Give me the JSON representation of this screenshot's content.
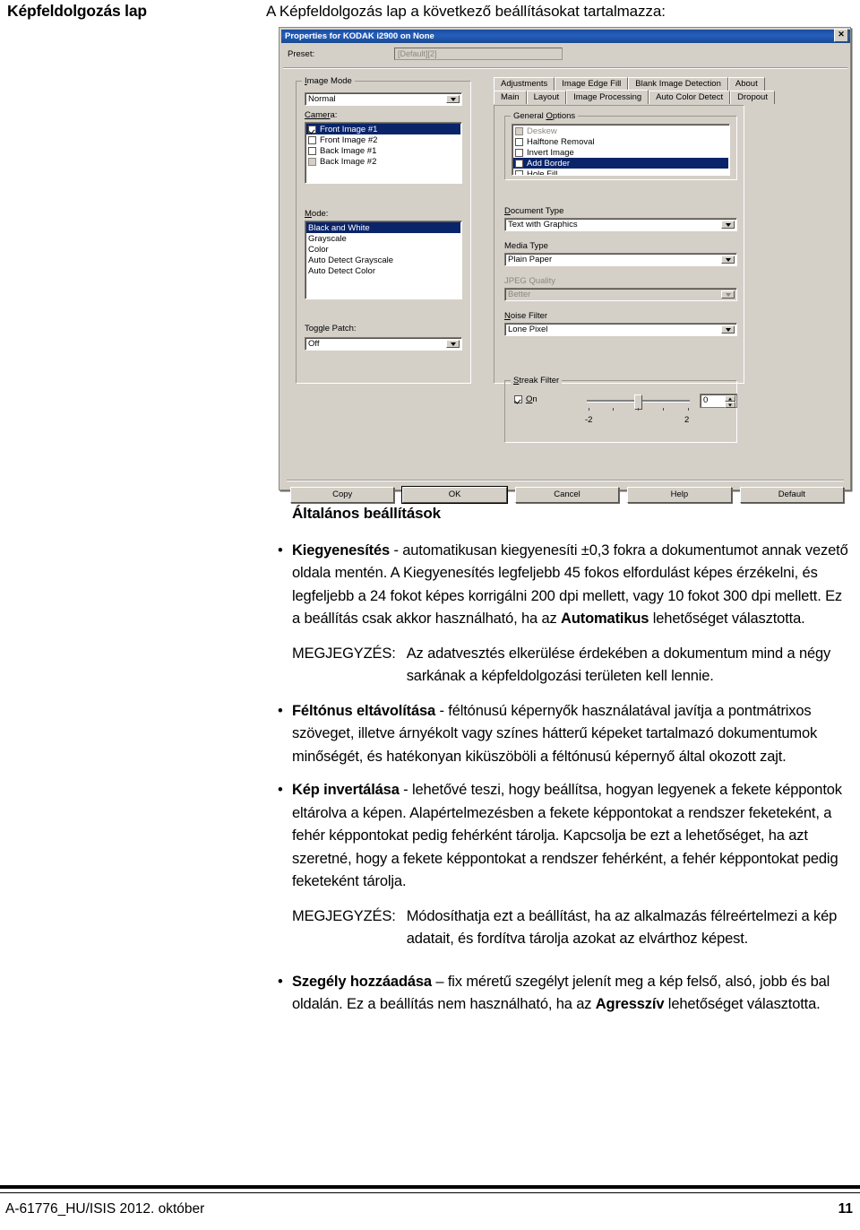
{
  "header": {
    "title": "Képfeldolgozás lap",
    "intro": "A Képfeldolgozás lap a következő beállításokat tartalmazza:"
  },
  "dialog": {
    "title": "Properties for KODAK i2900 on None",
    "close_icon": "close-icon",
    "preset_label": "Preset:",
    "preset_value": "[Default][2]",
    "image_mode": {
      "legend": "Image Mode",
      "mode_value": "Normal",
      "camera_label": "Camera:",
      "camera_items": [
        {
          "label": "Front Image #1",
          "checked": true,
          "selected": true,
          "dim": false
        },
        {
          "label": "Front Image #2",
          "checked": false,
          "selected": false,
          "dim": false
        },
        {
          "label": "Back Image #1",
          "checked": false,
          "selected": false,
          "dim": false
        },
        {
          "label": "Back Image #2",
          "checked": false,
          "selected": false,
          "dim": true
        }
      ],
      "mode_list_label": "Mode:",
      "mode_items": [
        {
          "label": "Black and White",
          "selected": true
        },
        {
          "label": "Grayscale",
          "selected": false
        },
        {
          "label": "Color",
          "selected": false
        },
        {
          "label": "Auto Detect Grayscale",
          "selected": false
        },
        {
          "label": "Auto Detect Color",
          "selected": false
        }
      ],
      "toggle_patch_label": "Toggle Patch:",
      "toggle_patch_value": "Off"
    },
    "tabs_row1": [
      {
        "label": "Adjustments",
        "active": false
      },
      {
        "label": "Image Edge Fill",
        "active": false
      },
      {
        "label": "Blank Image Detection",
        "active": false
      },
      {
        "label": "About",
        "active": false
      }
    ],
    "tabs_row2": [
      {
        "label": "Main",
        "active": false
      },
      {
        "label": "Layout",
        "active": false
      },
      {
        "label": "Image Processing",
        "active": true
      },
      {
        "label": "Auto Color Detect",
        "active": false
      },
      {
        "label": "Dropout",
        "active": false
      }
    ],
    "general_options": {
      "legend": "General Options",
      "items": [
        {
          "label": "Deskew",
          "checked": false,
          "selected": false,
          "dim": true
        },
        {
          "label": "Halftone Removal",
          "checked": false,
          "selected": false,
          "dim": false
        },
        {
          "label": "Invert Image",
          "checked": false,
          "selected": false,
          "dim": false
        },
        {
          "label": "Add Border",
          "checked": false,
          "selected": true,
          "dim": false
        },
        {
          "label": "Hole Fill",
          "checked": false,
          "selected": false,
          "dim": false
        }
      ]
    },
    "document_type_label": "Document Type",
    "document_type_value": "Text with Graphics",
    "media_type_label": "Media Type",
    "media_type_value": "Plain Paper",
    "jpeg_quality_label": "JPEG Quality",
    "jpeg_quality_value": "Better",
    "noise_filter_label": "Noise Filter",
    "noise_filter_value": "Lone Pixel",
    "streak_filter": {
      "legend": "Streak Filter",
      "on_label": "On",
      "on_checked": true,
      "value": "0",
      "min_label": "-2",
      "max_label": "2"
    },
    "buttons": [
      {
        "label": "Copy",
        "default": false
      },
      {
        "label": "OK",
        "default": true
      },
      {
        "label": "Cancel",
        "default": false
      },
      {
        "label": "Help",
        "default": false
      },
      {
        "label": "Default",
        "default": false
      }
    ]
  },
  "content": {
    "section_heading": "Általános beállítások",
    "bullet1_prefix": "Kiegyenesítés",
    "bullet1_rest": " - automatikusan kiegyenesíti ±0,3 fokra a dokumentumot annak vezető oldala mentén. A Kiegyenesítés legfeljebb 45 fokos elfordulást képes érzékelni, és legfeljebb a 24 fokot képes korrigálni 200 dpi mellett, vagy 10 fokot 300 dpi mellett. Ez a beállítás csak akkor használható, ha az ",
    "bullet1_bold2": "Automatikus",
    "bullet1_tail": " lehetőséget választotta.",
    "note1_label": "MEGJEGYZÉS:",
    "note1_body": "Az adatvesztés elkerülése érdekében a dokumentum mind a négy sarkának a képfeldolgozási területen kell lennie.",
    "bullet2_prefix": "Féltónus eltávolítása",
    "bullet2_rest": " - féltónusú képernyők használatával javítja a pontmátrixos szöveget, illetve árnyékolt vagy színes hátterű képeket tartalmazó dokumentumok minőségét, és hatékonyan kiküszöböli a féltónusú képernyő által okozott zajt.",
    "bullet3_prefix": "Kép invertálása",
    "bullet3_rest": " - lehetővé teszi, hogy beállítsa, hogyan legyenek a fekete képpontok eltárolva a képen. Alapértelmezésben a fekete képpontokat a rendszer feketeként, a fehér képpontokat pedig fehérként tárolja. Kapcsolja be ezt a lehetőséget, ha azt szeretné, hogy a fekete képpontokat a rendszer fehérként, a fehér képpontokat pedig feketeként tárolja.",
    "note2_label": "MEGJEGYZÉS:",
    "note2_body": "Módosíthatja ezt a beállítást, ha az alkalmazás félreértelmezi a kép adatait, és fordítva tárolja azokat az elvárthoz képest.",
    "bullet4_prefix": "Szegély hozzáadása",
    "bullet4_rest": " – fix méretű szegélyt jelenít meg a kép felső, alsó, jobb és bal oldalán. Ez a beállítás nem használható, ha az ",
    "bullet4_bold2": "Agresszív",
    "bullet4_tail": " lehetőséget választotta."
  },
  "footer": {
    "left": "A-61776_HU/ISIS 2012. október",
    "right": "11"
  },
  "colors": {
    "dialog_face": "#d4d0c8",
    "titlebar": "#1c4d9e",
    "selection": "#0a246a",
    "disabled_text": "#8c8880"
  }
}
